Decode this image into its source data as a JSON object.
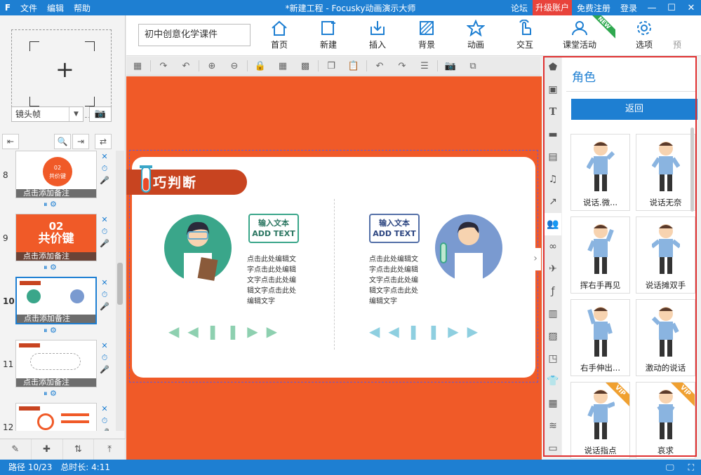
{
  "titlebar": {
    "logo": "F",
    "menu": [
      "文件",
      "编辑",
      "帮助"
    ],
    "title": "*新建工程 - Focusky动画演示大师",
    "links": [
      "论坛",
      "升级账户",
      "免费注册",
      "登录"
    ],
    "win": [
      "—",
      "☐",
      "✕"
    ]
  },
  "project_name": "初中创意化学课件",
  "tools": [
    "首页",
    "新建",
    "插入",
    "背景",
    "动画",
    "交互",
    "课堂活动",
    "选项",
    "预"
  ],
  "new_badge": "NEW",
  "left": {
    "lens_label": "镜头帧",
    "slides": [
      {
        "num": "8",
        "note": "点击添加备注",
        "title_small": "02",
        "title_big": "共价键"
      },
      {
        "num": "9",
        "note": "点击添加备注",
        "title_small": "02",
        "title_big": "共价键"
      },
      {
        "num": "10",
        "note": "点击添加备注"
      },
      {
        "num": "11",
        "note": "点击添加备注"
      },
      {
        "num": "12",
        "note": ""
      }
    ]
  },
  "canvas": {
    "banner": "巧判断",
    "bubble_left": {
      "line1": "输入文本",
      "line2": "ADD TEXT"
    },
    "bubble_right": {
      "line1": "输入文本",
      "line2": "ADD TEXT"
    },
    "text_left": [
      "点击此处编辑文",
      "字点击此处编辑",
      "文字点击此处编",
      "辑文字点击此处",
      "编辑文字"
    ],
    "text_right": [
      "点击此处编辑文",
      "字点击此处编辑",
      "文字点击此处编",
      "辑文字点击此处",
      "编辑文字"
    ]
  },
  "panel": {
    "title": "角色",
    "back": "返回",
    "items": [
      {
        "label": "说话.微...",
        "vip": false
      },
      {
        "label": "说话无奈",
        "vip": false
      },
      {
        "label": "挥右手再见",
        "vip": false
      },
      {
        "label": "说话摊双手",
        "vip": false
      },
      {
        "label": "右手伸出...",
        "vip": false
      },
      {
        "label": "激动的说话",
        "vip": false
      },
      {
        "label": "说话指点",
        "vip": true
      },
      {
        "label": "哀求",
        "vip": true
      }
    ],
    "vip_text": "VIP"
  },
  "status": {
    "path": "路径 10/23",
    "total": "总时长: 4:11"
  },
  "colors": {
    "accent": "#1e7fd2",
    "canvas_bg": "#f05a28",
    "highlight": "#e03030"
  }
}
